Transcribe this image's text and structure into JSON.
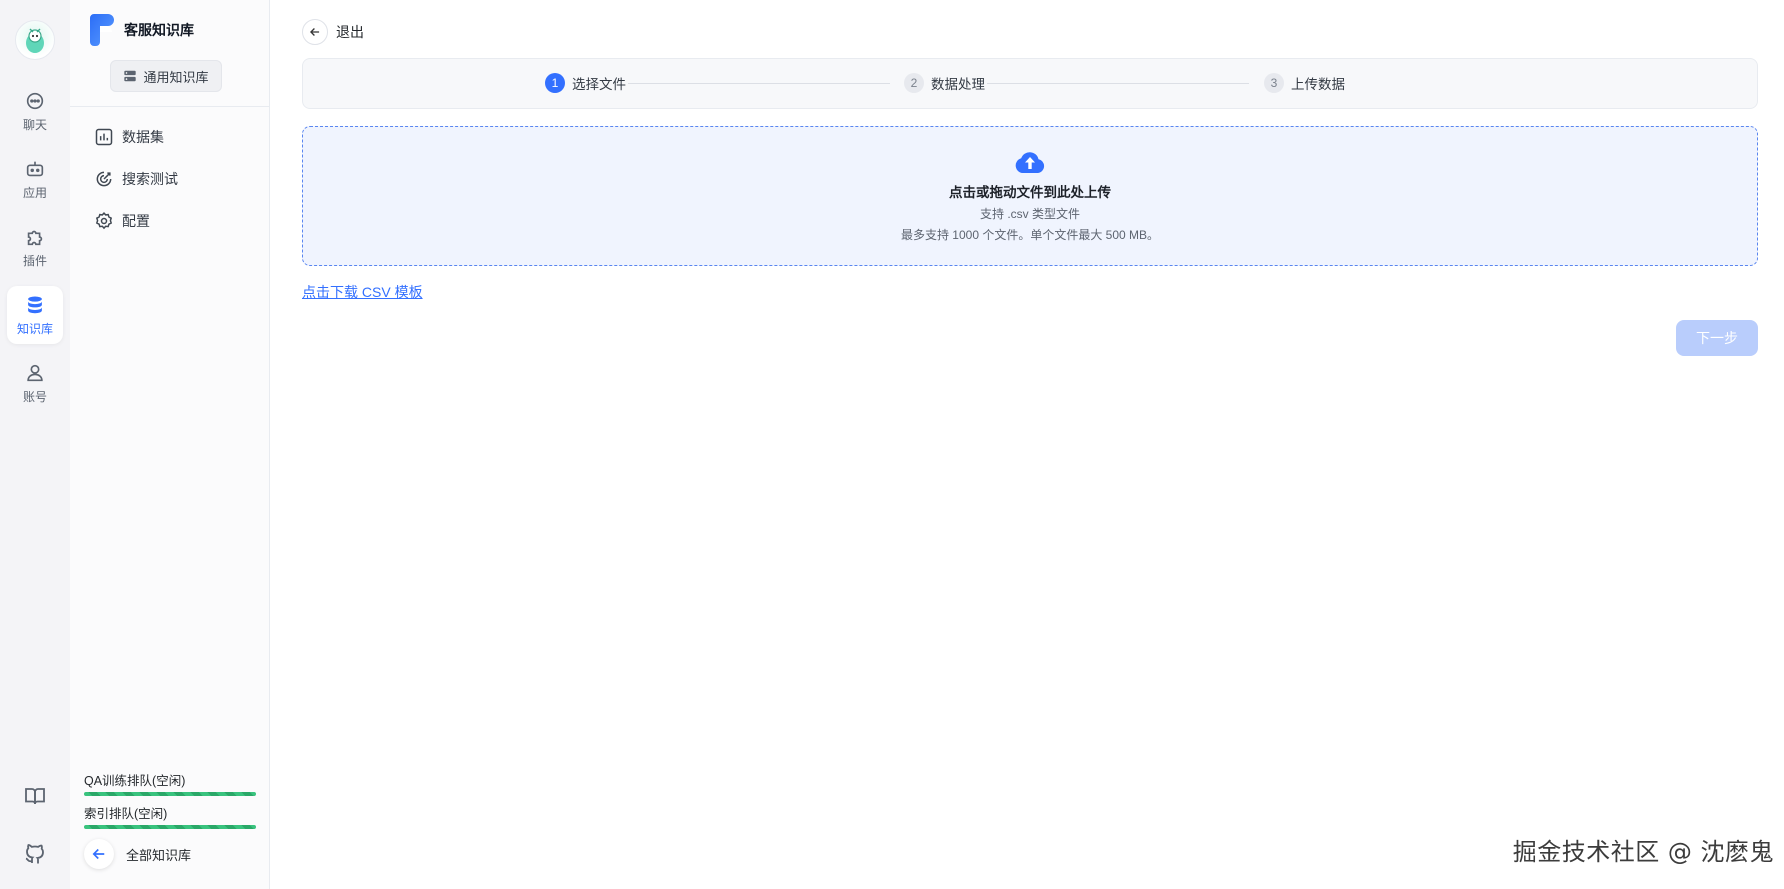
{
  "rail": {
    "items": [
      {
        "label": "聊天",
        "icon": "chat-icon"
      },
      {
        "label": "应用",
        "icon": "robot-icon"
      },
      {
        "label": "插件",
        "icon": "puzzle-icon"
      },
      {
        "label": "知识库",
        "icon": "database-icon",
        "active": true
      },
      {
        "label": "账号",
        "icon": "user-icon"
      }
    ],
    "bottom": [
      "book-icon",
      "github-icon"
    ]
  },
  "kb": {
    "title": "客服知识库",
    "type_label": "通用知识库",
    "menu": [
      {
        "label": "数据集",
        "icon": "chart-icon"
      },
      {
        "label": "搜索测试",
        "icon": "target-icon"
      },
      {
        "label": "配置",
        "icon": "gear-icon"
      }
    ],
    "queues": [
      {
        "label": "QA训练排队(空闲)"
      },
      {
        "label": "索引排队(空闲)"
      }
    ],
    "all_label": "全部知识库"
  },
  "main": {
    "exit_label": "退出",
    "steps": [
      {
        "num": "1",
        "label": "选择文件",
        "active": true
      },
      {
        "num": "2",
        "label": "数据处理"
      },
      {
        "num": "3",
        "label": "上传数据"
      }
    ],
    "upload": {
      "title": "点击或拖动文件到此处上传",
      "support": "支持 .csv 类型文件",
      "limit": "最多支持 1000 个文件。单个文件最大 500 MB。"
    },
    "template_link": "点击下载 CSV 模板",
    "next_label": "下一步"
  },
  "watermark": "掘金技术社区 @ 沈麽鬼",
  "colors": {
    "accent": "#3370ff",
    "queue_bar": "#39c37e",
    "next_disabled": "#b9cdfc"
  }
}
